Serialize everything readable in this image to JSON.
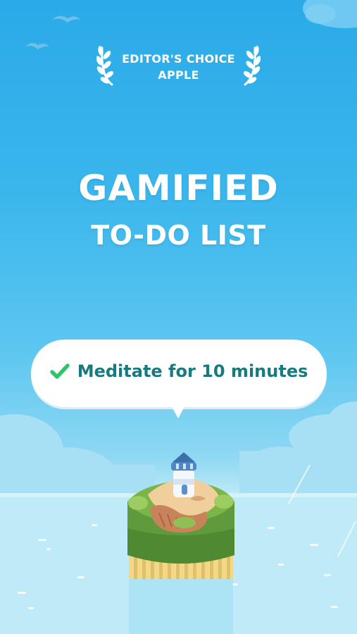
{
  "badge": {
    "line1": "EDITOR'S CHOICE",
    "line2": "APPLE",
    "icon": "laurel-wreath-icon"
  },
  "headline": {
    "line1": "GAMIFIED",
    "line2": "TO-DO LIST"
  },
  "task_bubble": {
    "status_icon": "check-icon",
    "text": "Meditate for 10 minutes"
  },
  "colors": {
    "sky_top": "#2aaae8",
    "sea": "#bde9f7",
    "check_green": "#2fc46b",
    "task_text": "#187a80",
    "headline_text": "#ffffff"
  }
}
